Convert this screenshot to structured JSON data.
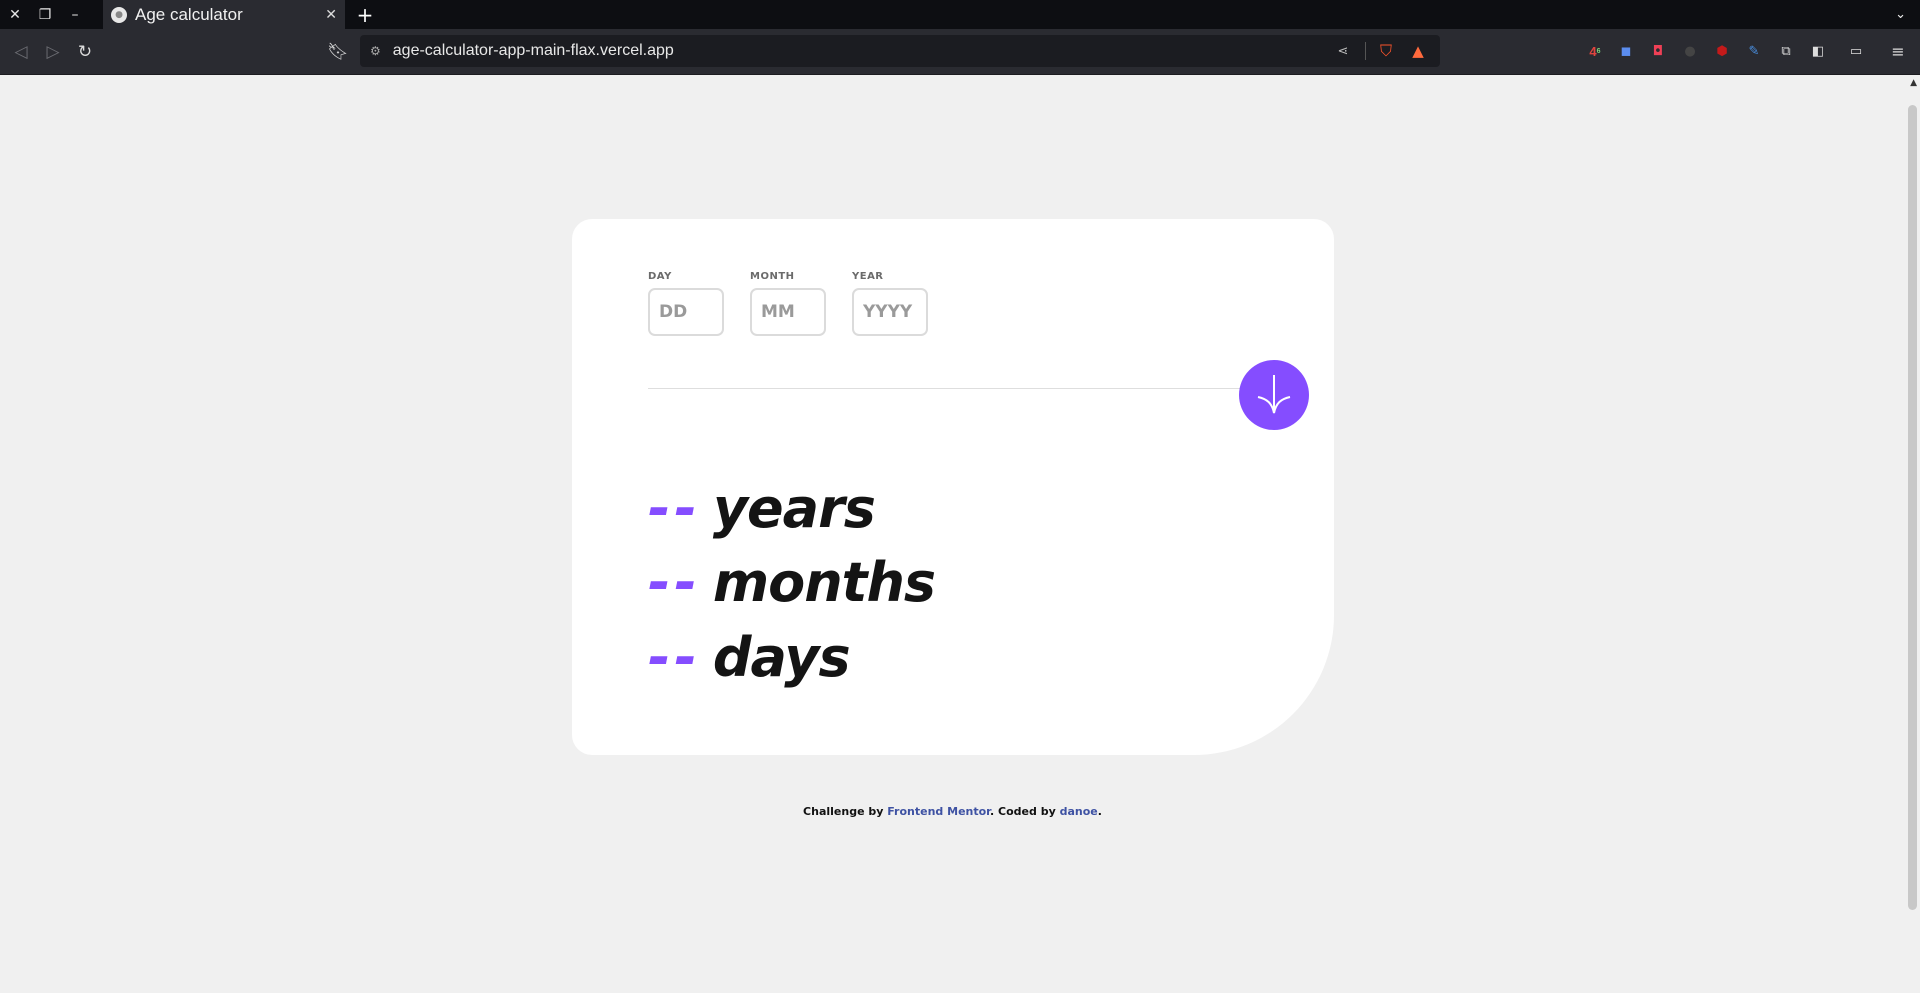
{
  "browser": {
    "tab_title": "Age calculator",
    "url": "age-calculator-app-main-flax.vercel.app",
    "ext_badge_count": "4",
    "ext_badge_sup": "6"
  },
  "form": {
    "day": {
      "label": "DAY",
      "placeholder": "DD"
    },
    "month": {
      "label": "MONTH",
      "placeholder": "MM"
    },
    "year": {
      "label": "YEAR",
      "placeholder": "YYYY"
    }
  },
  "results": {
    "years": {
      "value": "--",
      "unit": "years"
    },
    "months": {
      "value": "--",
      "unit": "months"
    },
    "days": {
      "value": "--",
      "unit": "days"
    }
  },
  "footer": {
    "prefix": "Challenge by ",
    "challenge_link": "Frontend Mentor",
    "middle": ". Coded by ",
    "author_link": "danoe",
    "suffix": "."
  },
  "colors": {
    "accent": "#854dff",
    "page_bg": "#f0f0f0",
    "link": "#3e52a3"
  }
}
